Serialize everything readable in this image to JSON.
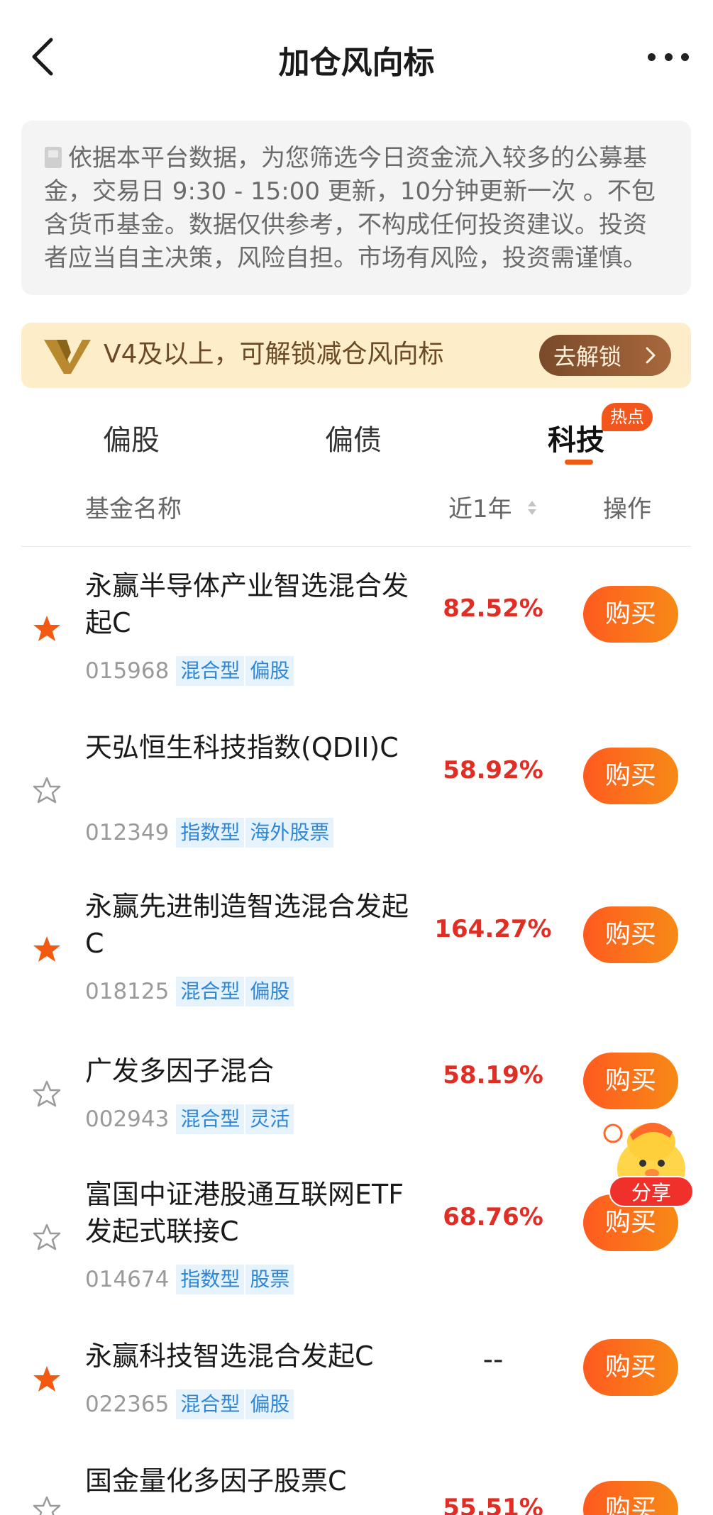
{
  "header": {
    "title": "加仓风向标"
  },
  "notice": {
    "text": "依据本平台数据，为您筛选今日资金流入较多的公募基金，交易日 9:30 - 15:00 更新，10分钟更新一次 。不包含货币基金。数据仅供参考，不构成任何投资建议。投资者应当自主决策，风险自担。市场有风险，投资需谨慎。"
  },
  "vip_banner": {
    "text": "V4及以上，可解锁减仓风向标",
    "button_label": "去解锁"
  },
  "tabs": [
    {
      "label": "偏股",
      "active": false
    },
    {
      "label": "偏债",
      "active": false
    },
    {
      "label": "科技",
      "active": true,
      "badge": "热点"
    }
  ],
  "columns": {
    "name": "基金名称",
    "return": "近1年",
    "action": "操作"
  },
  "funds": [
    {
      "name": "永赢半导体产业智选混合发起C",
      "code": "015968",
      "tags": [
        "混合型",
        "偏股"
      ],
      "return": "82.52%",
      "starred": true,
      "buy_label": "购买"
    },
    {
      "name": "天弘恒生科技指数(QDII)C",
      "code": "012349",
      "tags": [
        "指数型",
        "海外股票"
      ],
      "return": "58.92%",
      "starred": false,
      "buy_label": "购买"
    },
    {
      "name": "永赢先进制造智选混合发起C",
      "code": "018125",
      "tags": [
        "混合型",
        "偏股"
      ],
      "return": "164.27%",
      "starred": true,
      "buy_label": "购买"
    },
    {
      "name": "广发多因子混合",
      "code": "002943",
      "tags": [
        "混合型",
        "灵活"
      ],
      "return": "58.19%",
      "starred": false,
      "buy_label": "购买"
    },
    {
      "name": "富国中证港股通互联网ETF发起式联接C",
      "code": "014674",
      "tags": [
        "指数型",
        "股票"
      ],
      "return": "68.76%",
      "starred": false,
      "buy_label": "购买"
    },
    {
      "name": "永赢科技智选混合发起C",
      "code": "022365",
      "tags": [
        "混合型",
        "偏股"
      ],
      "return": "--",
      "starred": true,
      "buy_label": "购买"
    },
    {
      "name": "国金量化多因子股票C",
      "code": "",
      "tags": [],
      "return": "55.51%",
      "starred": false,
      "buy_label": "购买"
    }
  ],
  "floating": {
    "share_label": "分享"
  },
  "colors": {
    "accent_orange": "#f25a12",
    "return_red": "#e02e24",
    "star_orange": "#f25a12",
    "tag_blue": "#2f86d6",
    "vip_brown": "#7a4a2a"
  }
}
